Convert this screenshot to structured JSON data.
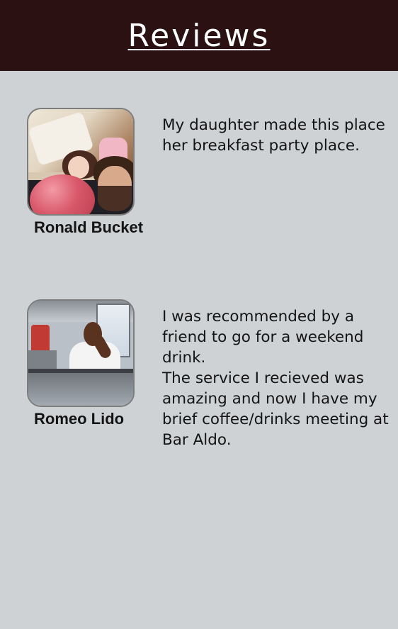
{
  "header": {
    "title": "Reviews"
  },
  "reviews": [
    {
      "name": "Ronald Bucket",
      "text": "My daughter made this place her breakfast party place.",
      "avatar_icon": "reviewer-photo"
    },
    {
      "name": "Romeo Lido",
      "text": "I was recommended by a friend to go for a weekend drink.\nThe service I recieved was amazing and now I have my brief coffee/drinks meeting at Bar Aldo.",
      "avatar_icon": "reviewer-photo"
    }
  ],
  "colors": {
    "header_bg": "#2b1112",
    "page_bg": "#cfd2d5",
    "header_text": "#ffffff",
    "body_text": "#141414"
  }
}
